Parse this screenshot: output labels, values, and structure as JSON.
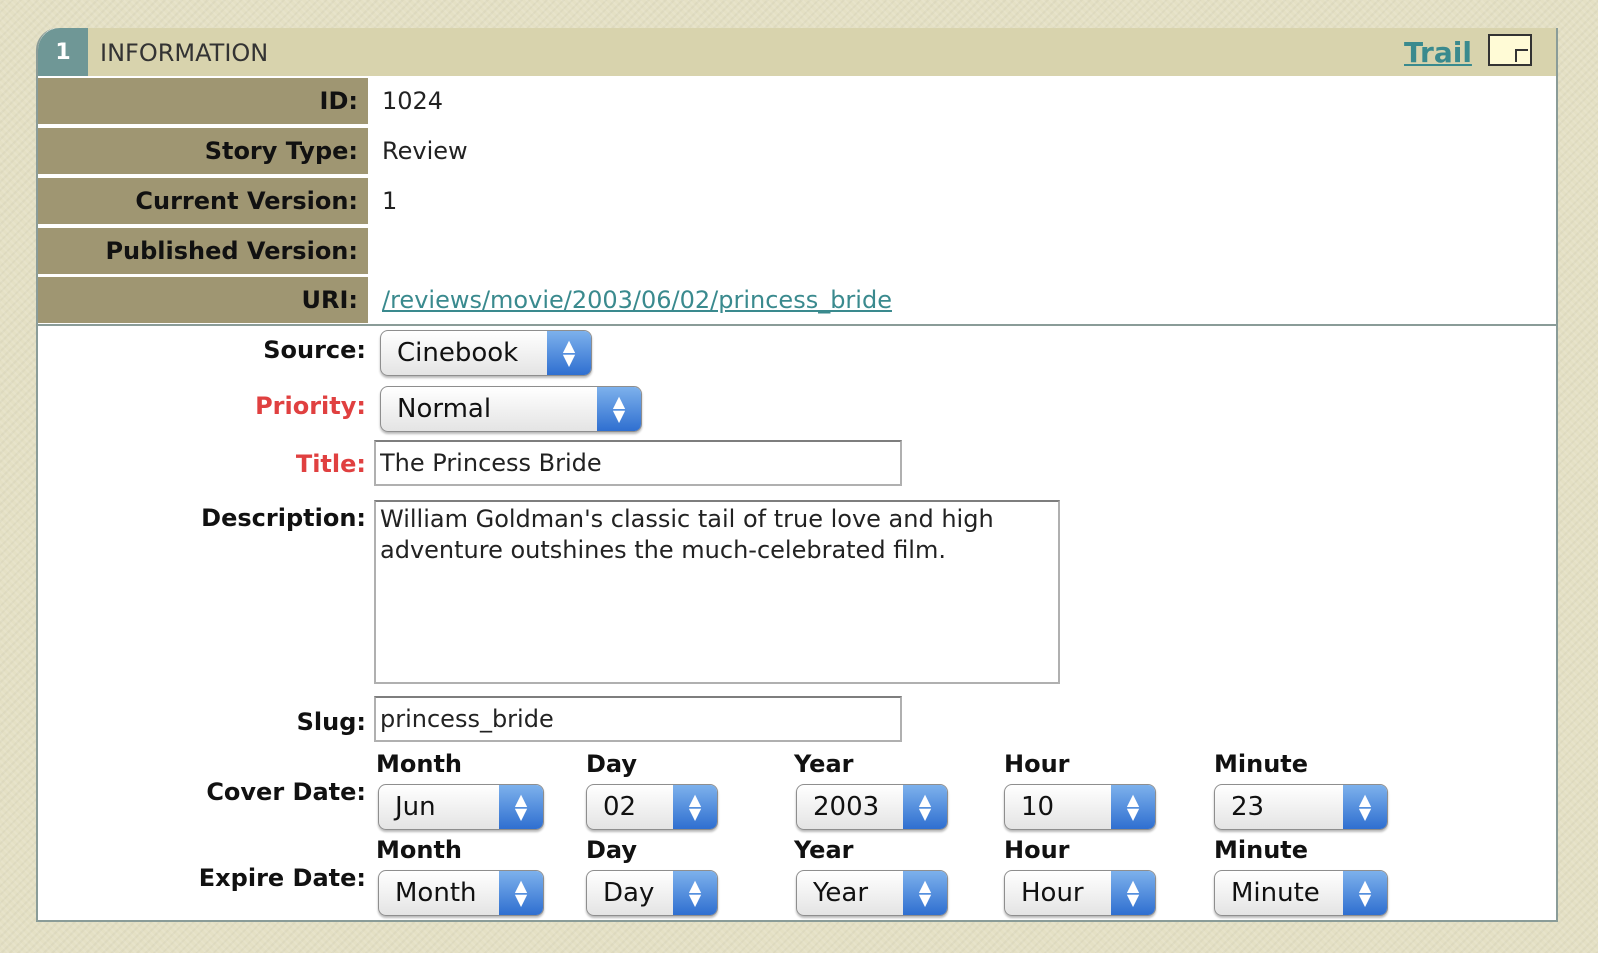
{
  "section": {
    "number": "1",
    "title": "INFORMATION",
    "trail_label": "Trail"
  },
  "info": {
    "id_label": "ID:",
    "id_value": "1024",
    "story_type_label": "Story Type:",
    "story_type_value": "Review",
    "current_version_label": "Current Version:",
    "current_version_value": "1",
    "published_version_label": "Published Version:",
    "published_version_value": "",
    "uri_label": "URI:",
    "uri_value": "/reviews/movie/2003/06/02/princess_bride"
  },
  "form": {
    "source_label": "Source:",
    "source_value": "Cinebook",
    "priority_label": "Priority:",
    "priority_value": "Normal",
    "title_label": "Title:",
    "title_value": "The Princess Bride",
    "description_label": "Description:",
    "description_value": "William Goldman's classic tail of true love and high adventure outshines the much-celebrated film.",
    "slug_label": "Slug:",
    "slug_value": "princess_bride"
  },
  "dates": {
    "sub_month": "Month",
    "sub_day": "Day",
    "sub_year": "Year",
    "sub_hour": "Hour",
    "sub_minute": "Minute",
    "cover_label": "Cover Date:",
    "cover": {
      "month": "Jun",
      "day": "02",
      "year": "2003",
      "hour": "10",
      "minute": "23"
    },
    "expire_label": "Expire Date:",
    "expire": {
      "month": "Month",
      "day": "Day",
      "year": "Year",
      "hour": "Hour",
      "minute": "Minute"
    }
  },
  "colors": {
    "header_bg": "#d8d3ad",
    "label_bg": "#9f9672",
    "accent_teal": "#3a8a8e",
    "required_red": "#e04040",
    "select_arrow_blue": "#2f6fd0"
  }
}
